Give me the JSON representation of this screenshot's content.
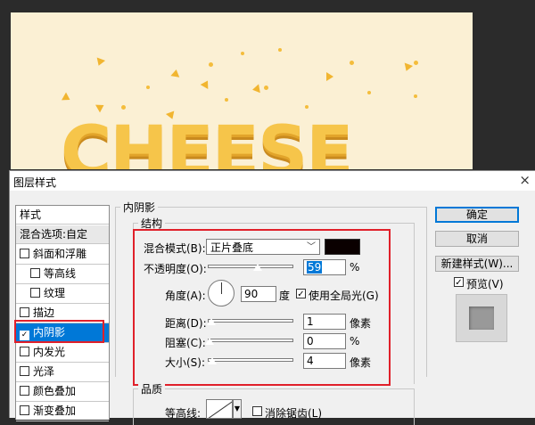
{
  "dialog": {
    "title": "图层样式",
    "close_glyph": "×"
  },
  "styles_list": {
    "header": "样式",
    "items": [
      {
        "label": "混合选项:自定",
        "checkbox": false,
        "checked": false
      },
      {
        "label": "斜面和浮雕",
        "checkbox": true,
        "checked": false
      },
      {
        "label": "等高线",
        "checkbox": true,
        "checked": false,
        "indent": true
      },
      {
        "label": "纹理",
        "checkbox": true,
        "checked": false,
        "indent": true
      },
      {
        "label": "描边",
        "checkbox": true,
        "checked": false
      },
      {
        "label": "内阴影",
        "checkbox": true,
        "checked": true,
        "active": true
      },
      {
        "label": "内发光",
        "checkbox": true,
        "checked": false
      },
      {
        "label": "光泽",
        "checkbox": true,
        "checked": false
      },
      {
        "label": "颜色叠加",
        "checkbox": true,
        "checked": false
      },
      {
        "label": "渐变叠加",
        "checkbox": true,
        "checked": false
      }
    ]
  },
  "inner_shadow": {
    "section_title": "内阴影",
    "structure_title": "结构",
    "blend_mode_label": "混合模式(B):",
    "blend_mode_value": "正片叠底",
    "shadow_color": "#0a0000",
    "opacity_label": "不透明度(O):",
    "opacity_value": "59",
    "opacity_unit": "%",
    "angle_label": "角度(A):",
    "angle_value": "90",
    "angle_unit": "度",
    "global_light_label": "使用全局光(G)",
    "global_light_checked": true,
    "distance_label": "距离(D):",
    "distance_value": "1",
    "distance_unit": "像素",
    "choke_label": "阻塞(C):",
    "choke_value": "0",
    "choke_unit": "%",
    "size_label": "大小(S):",
    "size_value": "4",
    "size_unit": "像素",
    "quality_title": "品质",
    "contour_label": "等高线:",
    "anti_alias_label": "消除锯齿(L)"
  },
  "buttons": {
    "ok": "确定",
    "cancel": "取消",
    "new_style": "新建样式(W)...",
    "preview_label": "预览(V)",
    "preview_checked": true
  },
  "canvas": {
    "text": "CHEESE",
    "background_color": "#fbf0d4",
    "text_color": "#f6c54a"
  },
  "check_glyph": "☑",
  "uncheck_glyph": "☐"
}
